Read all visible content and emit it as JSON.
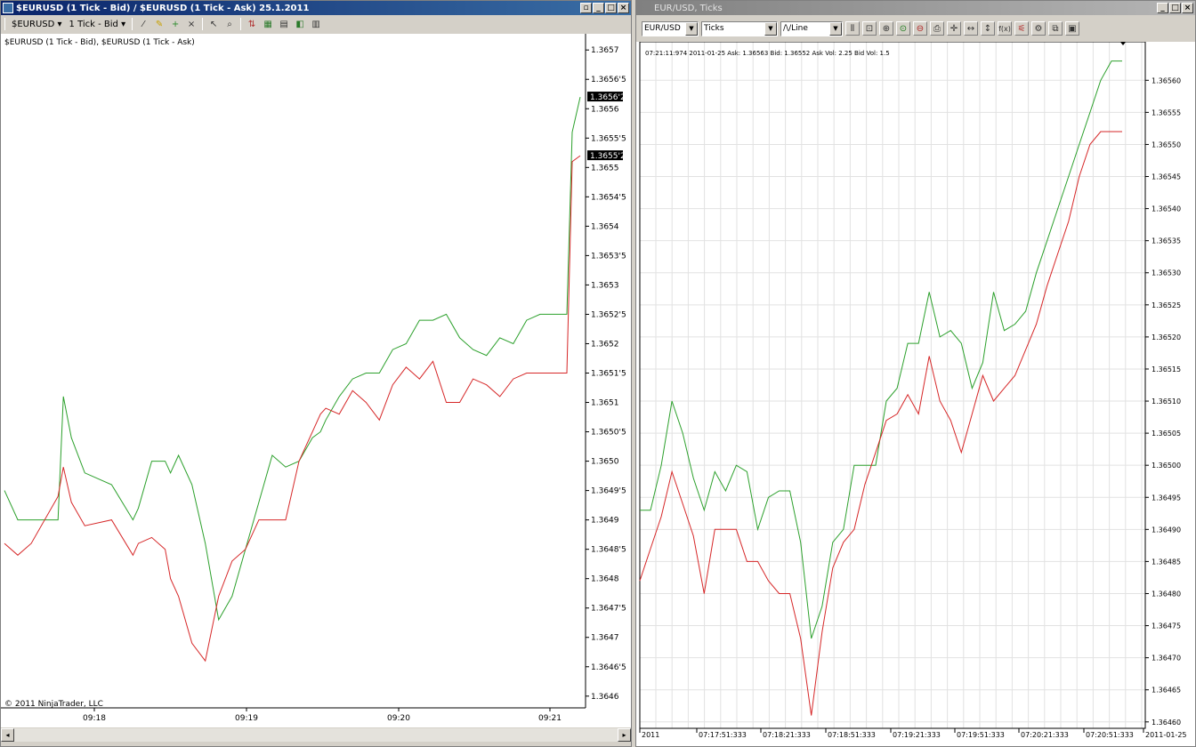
{
  "left": {
    "title": "$EURUSD (1 Tick - Bid) / $EURUSD (1 Tick - Ask)  25.1.2011",
    "toolbar": {
      "instrument": "$EURUSD",
      "period": "1 Tick - Bid"
    },
    "legend": "$EURUSD (1 Tick - Bid), $EURUSD (1 Tick - Ask)",
    "copyright": "© 2011 NinjaTrader, LLC",
    "y_ticks": [
      "1.3657",
      "1.3656'5",
      "1.3656",
      "1.3655'5",
      "1.3655",
      "1.3654'5",
      "1.3654",
      "1.3653'5",
      "1.3653",
      "1.3652'5",
      "1.3652",
      "1.3651'5",
      "1.3651",
      "1.3650'5",
      "1.3650",
      "1.3649'5",
      "1.3649",
      "1.3648'5",
      "1.3648",
      "1.3647'5",
      "1.3647",
      "1.3646'5",
      "1.3646"
    ],
    "x_ticks": [
      "09:18",
      "09:19",
      "09:20",
      "09:21"
    ],
    "price_labels": [
      "1.3656'2",
      "1.3655'2"
    ]
  },
  "right": {
    "title": "EUR/USD,  Ticks",
    "toolbar": {
      "symbol": "EUR/USD",
      "interval": "Ticks",
      "style": "Line"
    },
    "info": "07:21:11:974 2011-01-25   Ask: 1.36563   Bid: 1.36552   Ask Vol: 2.25   Bid Vol: 1.5",
    "y_ticks": [
      "1.36560",
      "1.36555",
      "1.36550",
      "1.36545",
      "1.36540",
      "1.36535",
      "1.36530",
      "1.36525",
      "1.36520",
      "1.36515",
      "1.36510",
      "1.36505",
      "1.36500",
      "1.36495",
      "1.36490",
      "1.36485",
      "1.36480",
      "1.36475",
      "1.36470",
      "1.36465",
      "1.36460"
    ],
    "x_ticks": [
      "2011",
      "07:17:51:333",
      "07:18:21:333",
      "07:18:51:333",
      "07:19:21:333",
      "07:19:51:333",
      "07:20:21:333",
      "07:20:51:333",
      "2011-01-25"
    ]
  },
  "colors": {
    "ask": "#2ca02c",
    "bid": "#d62728",
    "title_active": "#0a246a"
  },
  "chart_data": [
    {
      "type": "line",
      "title": "$EURUSD (1 Tick - Bid), $EURUSD (1 Tick - Ask)",
      "x_unit": "time 09:17:38-09:21:14",
      "ylim": [
        1.36458,
        1.36572
      ],
      "series": [
        {
          "name": "$EURUSD (1 Tick - Ask)",
          "x": [
            0,
            5,
            10,
            20,
            22,
            25,
            30,
            40,
            48,
            50,
            55,
            60,
            62,
            65,
            70,
            75,
            80,
            85,
            90,
            95,
            100,
            105,
            110,
            115,
            118,
            120,
            125,
            130,
            135,
            140,
            145,
            150,
            155,
            160,
            165,
            170,
            175,
            180,
            185,
            190,
            195,
            200,
            205,
            210,
            212,
            215
          ],
          "y": [
            1.36495,
            1.3649,
            1.3649,
            1.3649,
            1.36511,
            1.36504,
            1.36498,
            1.36496,
            1.3649,
            1.36492,
            1.365,
            1.365,
            1.36498,
            1.36501,
            1.36496,
            1.36486,
            1.36473,
            1.36477,
            1.36485,
            1.36493,
            1.36501,
            1.36499,
            1.365,
            1.36504,
            1.36505,
            1.36507,
            1.36511,
            1.36514,
            1.36515,
            1.36515,
            1.36519,
            1.3652,
            1.36524,
            1.36524,
            1.36525,
            1.36521,
            1.36519,
            1.36518,
            1.36521,
            1.3652,
            1.36524,
            1.36525,
            1.36525,
            1.36525,
            1.36556,
            1.36562
          ]
        },
        {
          "name": "$EURUSD (1 Tick - Bid)",
          "x": [
            0,
            5,
            10,
            20,
            22,
            25,
            30,
            40,
            48,
            50,
            55,
            60,
            62,
            65,
            70,
            75,
            80,
            85,
            90,
            95,
            100,
            105,
            110,
            115,
            118,
            120,
            125,
            130,
            135,
            140,
            145,
            150,
            155,
            160,
            165,
            170,
            175,
            180,
            185,
            190,
            195,
            200,
            205,
            210,
            212,
            215
          ],
          "y": [
            1.36486,
            1.36484,
            1.36486,
            1.36494,
            1.36499,
            1.36493,
            1.36489,
            1.3649,
            1.36484,
            1.36486,
            1.36487,
            1.36485,
            1.3648,
            1.36477,
            1.36469,
            1.36466,
            1.36477,
            1.36483,
            1.36485,
            1.3649,
            1.3649,
            1.3649,
            1.365,
            1.36505,
            1.36508,
            1.36509,
            1.36508,
            1.36512,
            1.3651,
            1.36507,
            1.36513,
            1.36516,
            1.36514,
            1.36517,
            1.3651,
            1.3651,
            1.36514,
            1.36513,
            1.36511,
            1.36514,
            1.36515,
            1.36515,
            1.36515,
            1.36515,
            1.36551,
            1.36552
          ]
        }
      ]
    },
    {
      "type": "line",
      "title": "EUR/USD,  Ticks",
      "x_unit": "time 07:17:27-07:21:12",
      "ylim": [
        1.36459,
        1.36566
      ],
      "series": [
        {
          "name": "Ask",
          "x": [
            0,
            5,
            10,
            15,
            20,
            25,
            30,
            35,
            40,
            45,
            50,
            55,
            60,
            65,
            70,
            75,
            80,
            85,
            90,
            95,
            100,
            105,
            110,
            115,
            120,
            125,
            130,
            135,
            140,
            145,
            150,
            155,
            160,
            165,
            170,
            175,
            180,
            185,
            190,
            195,
            200,
            205,
            210,
            215,
            220,
            225
          ],
          "y": [
            1.36493,
            1.36493,
            1.365,
            1.3651,
            1.36505,
            1.36498,
            1.36493,
            1.36499,
            1.36496,
            1.365,
            1.36499,
            1.3649,
            1.36495,
            1.36496,
            1.36496,
            1.36488,
            1.36473,
            1.36478,
            1.36488,
            1.3649,
            1.365,
            1.365,
            1.365,
            1.3651,
            1.36512,
            1.36519,
            1.36519,
            1.36527,
            1.3652,
            1.36521,
            1.36519,
            1.36512,
            1.36516,
            1.36527,
            1.36521,
            1.36522,
            1.36524,
            1.3653,
            1.36535,
            1.3654,
            1.36545,
            1.3655,
            1.36555,
            1.3656,
            1.36563,
            1.36563
          ]
        },
        {
          "name": "Bid",
          "x": [
            0,
            5,
            10,
            15,
            20,
            25,
            30,
            35,
            40,
            45,
            50,
            55,
            60,
            65,
            70,
            75,
            80,
            85,
            90,
            95,
            100,
            105,
            110,
            115,
            120,
            125,
            130,
            135,
            140,
            145,
            150,
            155,
            160,
            165,
            170,
            175,
            180,
            185,
            190,
            195,
            200,
            205,
            210,
            215,
            220,
            225
          ],
          "y": [
            1.36482,
            1.36487,
            1.36492,
            1.36499,
            1.36494,
            1.36489,
            1.3648,
            1.3649,
            1.3649,
            1.3649,
            1.36485,
            1.36485,
            1.36482,
            1.3648,
            1.3648,
            1.36473,
            1.36461,
            1.36474,
            1.36484,
            1.36488,
            1.3649,
            1.36497,
            1.36502,
            1.36507,
            1.36508,
            1.36511,
            1.36508,
            1.36517,
            1.3651,
            1.36507,
            1.36502,
            1.36508,
            1.36514,
            1.3651,
            1.36512,
            1.36514,
            1.36518,
            1.36522,
            1.36528,
            1.36533,
            1.36538,
            1.36545,
            1.3655,
            1.36552,
            1.36552,
            1.36552
          ]
        }
      ]
    }
  ]
}
